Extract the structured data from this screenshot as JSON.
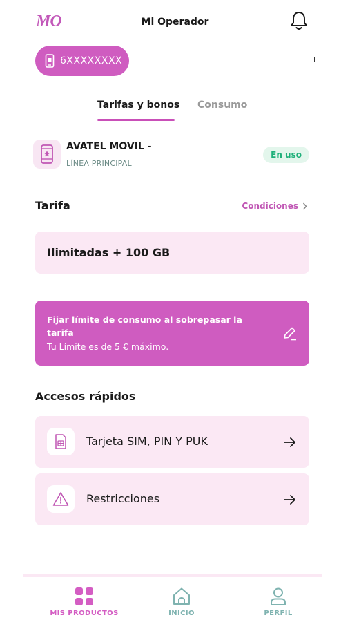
{
  "header": {
    "logo": "MO",
    "title": "Mi Operador"
  },
  "line_selector": {
    "phone": "6XXXXXXXX"
  },
  "tabs": [
    {
      "label": "Tarifas y bonos",
      "active": true
    },
    {
      "label": "Consumo",
      "active": false
    }
  ],
  "line": {
    "name": "AVATEL MOVIL -",
    "subtitle": "LÍNEA PRINCIPAL",
    "status": "En uso"
  },
  "tarifa": {
    "heading": "Tarifa",
    "conditions_link": "Condiciones",
    "plan": "Ilimitadas + 100 GB"
  },
  "limit": {
    "title": "Fijar límite de consumo al sobrepasar la tarifa",
    "subtitle": "Tu Límite es de 5 € máximo."
  },
  "quick_access": {
    "heading": "Accesos rápidos",
    "items": [
      {
        "label": "Tarjeta SIM, PIN Y PUK",
        "icon": "sim-card-icon"
      },
      {
        "label": "Restricciones",
        "icon": "warning-icon"
      }
    ]
  },
  "bottom_nav": [
    {
      "label": "MIS PRODUCTOS",
      "icon": "grid-icon",
      "active": true
    },
    {
      "label": "INICIO",
      "icon": "home-icon",
      "active": false
    },
    {
      "label": "PERFIL",
      "icon": "user-icon",
      "active": false
    }
  ],
  "colors": {
    "accent": "#cf5cc0",
    "accent_text": "#c056b4",
    "card_bg": "#fbe8f4",
    "badge_text": "#1fb07a",
    "teal_inactive": "#7fb3b0"
  }
}
